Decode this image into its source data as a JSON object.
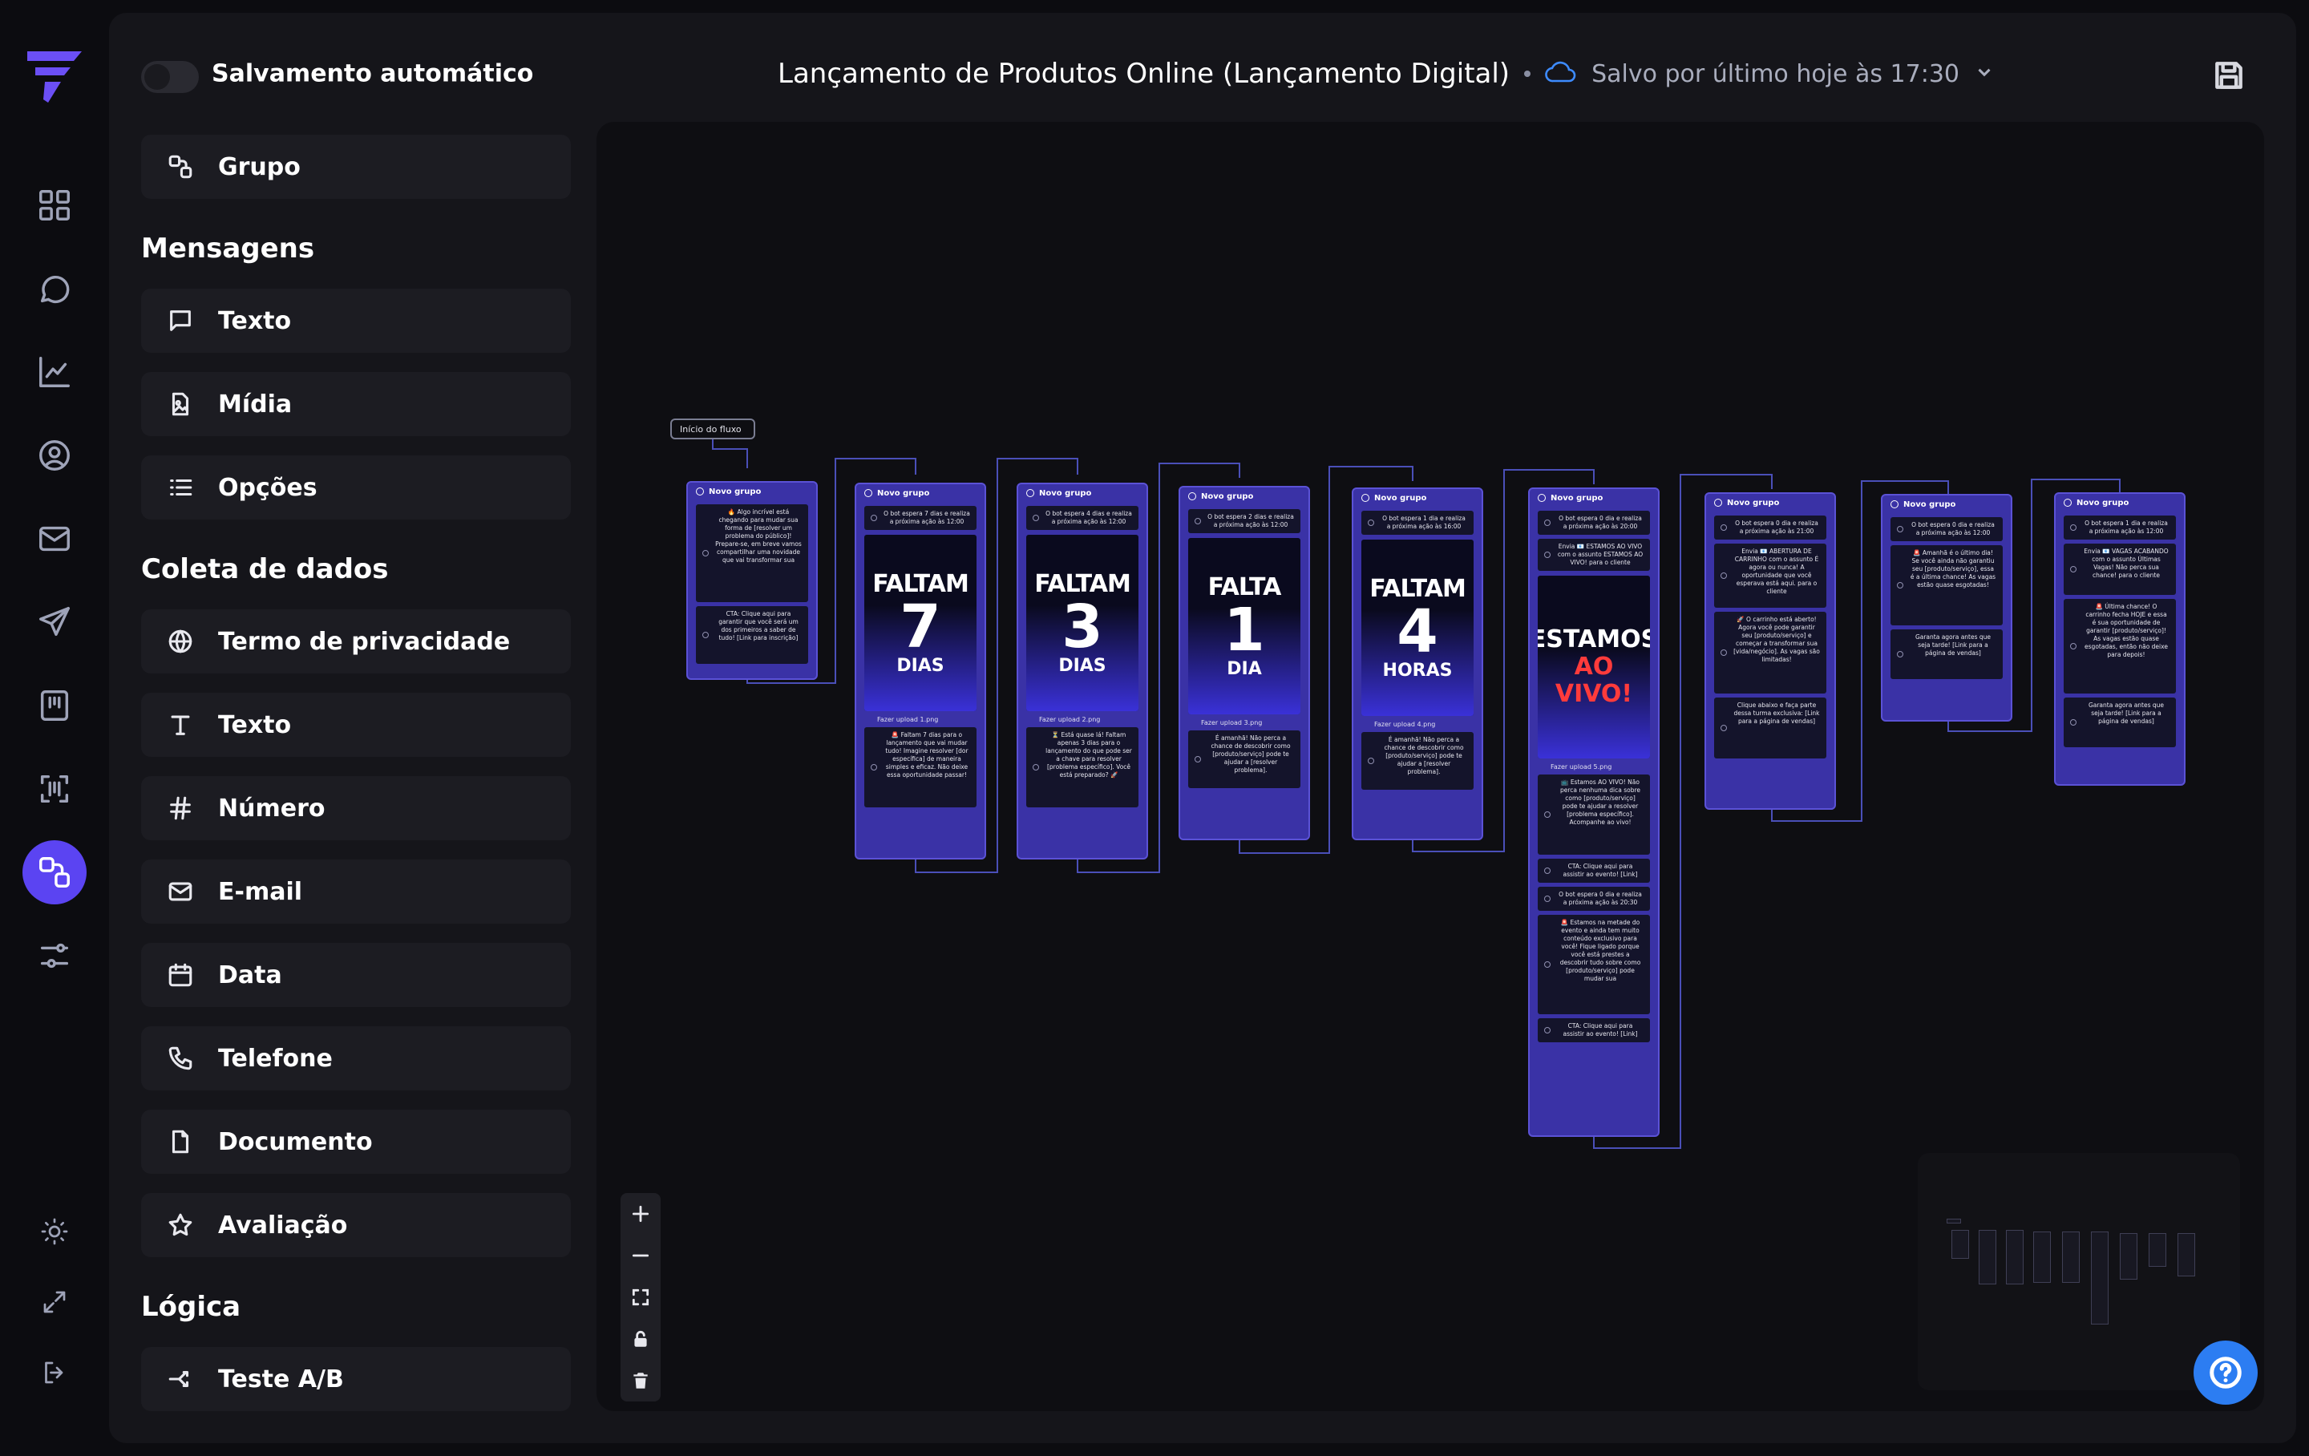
{
  "topbar": {
    "autosave_label": "Salvamento automático",
    "flow_title": "Lançamento de Produtos Online (Lançamento Digital)",
    "saved_status": "Salvo por último hoje às 17:30"
  },
  "sidebar": {
    "group_item": "Grupo",
    "headings": {
      "messages": "Mensagens",
      "data": "Coleta de dados",
      "logic": "Lógica"
    },
    "messages": [
      "Texto",
      "Mídia",
      "Opções"
    ],
    "data_items": [
      "Termo de privacidade",
      "Texto",
      "Número",
      "E-mail",
      "Data",
      "Telefone",
      "Documento",
      "Avaliação"
    ],
    "logic_items": [
      "Teste A/B"
    ]
  },
  "canvas": {
    "start_label": "Início do fluxo",
    "group_label": "Novo grupo",
    "upload_label": "Fazer upload",
    "nodes": [
      {
        "blocks": [
          "🔥 Algo incrível está chegando para mudar sua forma de [resolver um problema do público]! Prepare-se, em breve vamos compartilhar uma novidade que vai transformar sua",
          "CTA: Clique aqui para garantir que você será um dos primeiros a saber de tudo! [Link para inscrição]"
        ]
      },
      {
        "wait": "O bot espera 7 dias e realiza a próxima ação às 12:00",
        "poster": [
          "FALTAM",
          "7",
          "DIAS"
        ],
        "file": "1.png",
        "text": "🚨 Faltam 7 dias para o lançamento que vai mudar tudo! Imagine resolver [dor específica] de maneira simples e eficaz. Não deixe essa oportunidade passar!"
      },
      {
        "wait": "O bot espera 4 dias e realiza a próxima ação às 12:00",
        "poster": [
          "FALTAM",
          "3",
          "DIAS"
        ],
        "file": "2.png",
        "text": "⏳ Está quase lá! Faltam apenas 3 dias para o lançamento do que pode ser a chave para resolver [problema específico]. Você está preparado? 🚀"
      },
      {
        "wait": "O bot espera 2 dias e realiza a próxima ação às 12:00",
        "poster": [
          "FALTA",
          "1",
          "DIA"
        ],
        "file": "3.png",
        "text": "É amanhã! Não perca a chance de descobrir como [produto/serviço] pode te ajudar a [resolver problema]."
      },
      {
        "wait": "O bot espera 1 dia e realiza a próxima ação às 16:00",
        "poster": [
          "FALTAM",
          "4",
          "HORAS"
        ],
        "file": "4.png",
        "text": "É amanhã! Não perca a chance de descobrir como [produto/serviço] pode te ajudar a [resolver problema]."
      },
      {
        "wait": "O bot espera 0 dia e realiza a próxima ação às 20:00",
        "send": "Envia 📧 ESTAMOS AO VIVO com o assunto ESTAMOS AO VIVO! para o cliente",
        "poster": [
          "ESTAMOS",
          "AO",
          "VIVO!"
        ],
        "file": "5.png",
        "extra": [
          "📺 Estamos AO VIVO! Não perca nenhuma dica sobre como [produto/serviço] pode te ajudar a resolver [problema específico]. Acompanhe ao vivo!",
          "CTA: Clique aqui para assistir ao evento! [Link]",
          "O bot espera 0 dia e realiza a próxima ação às 20:30",
          "🚨 Estamos na metade do evento e ainda tem muito conteúdo exclusivo para você! Fique ligado porque você está prestes a descobrir tudo sobre como [produto/serviço] pode mudar sua",
          "CTA: Clique aqui para assistir ao evento! [Link]"
        ]
      },
      {
        "blocks": [
          "O bot espera 0 dia e realiza a próxima ação às 21:00",
          "Envia 📧 ABERTURA DE CARRINHO com o assunto É agora ou nunca! A oportunidade que você esperava está aqui. para o cliente",
          "🚀 O carrinho está aberto! Agora você pode garantir seu [produto/serviço] e começar a transformar sua [vida/negócio]. As vagas são limitadas!",
          "Clique abaixo e faça parte dessa turma exclusiva: [Link para a página de vendas]"
        ]
      },
      {
        "blocks": [
          "O bot espera 0 dia e realiza a próxima ação às 12:00",
          "🚨 Amanhã é o último dia! Se você ainda não garantiu seu [produto/serviço], essa é a última chance! As vagas estão quase esgotadas!",
          "Garanta agora antes que seja tarde! [Link para a página de vendas]"
        ]
      },
      {
        "blocks": [
          "O bot espera 1 dia e realiza a próxima ação às 12:00",
          "Envia 📧 VAGAS ACABANDO com o assunto Últimas Vagas! Não perca sua chance! para o cliente",
          "🚨 Última chance! O carrinho fecha HOJE e essa é sua oportunidade de garantir [produto/serviço]! As vagas estão quase esgotadas, então não deixe para depois!",
          "Garanta agora antes que seja tarde! [Link para a página de vendas]"
        ]
      }
    ]
  }
}
